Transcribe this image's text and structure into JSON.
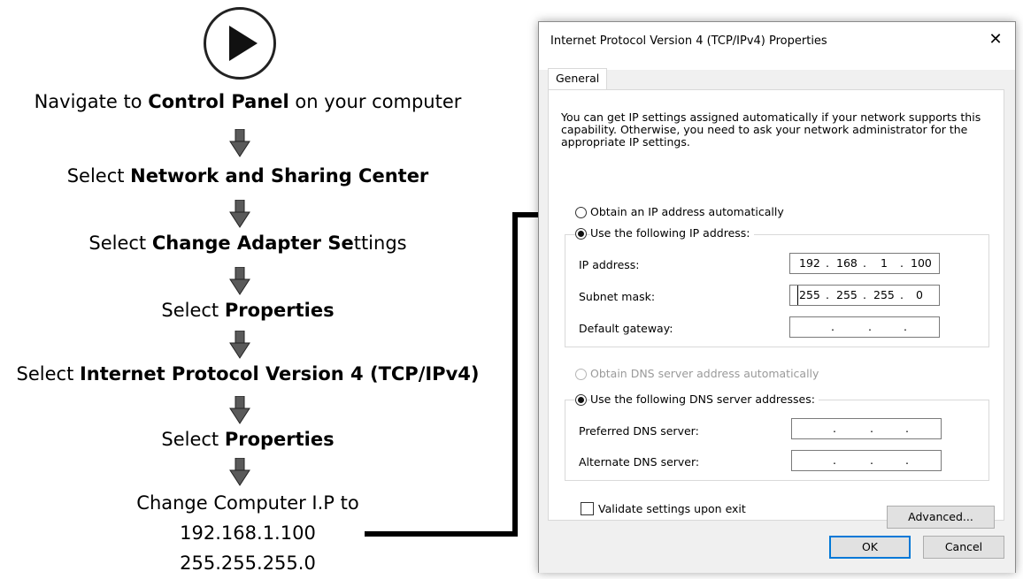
{
  "steps": {
    "items": [
      {
        "pre": "Navigate to ",
        "bold": "Control Panel",
        "post": " on your computer"
      },
      {
        "pre": "Select ",
        "bold": "Network and Sharing Center",
        "post": ""
      },
      {
        "pre": "Select ",
        "bold": "Change Adapter Se",
        "post": "ttings"
      },
      {
        "pre": "Select ",
        "bold": "Properties",
        "post": ""
      },
      {
        "pre": "Select ",
        "bold": "Internet Protocol Version 4 (TCP/IPv4)",
        "post": ""
      },
      {
        "pre": "Select ",
        "bold": "Properties",
        "post": ""
      }
    ],
    "final": {
      "line1": "Change Computer I.P to",
      "line2": "192.168.1.100",
      "line3": "255.255.255.0"
    }
  },
  "dialog": {
    "title": "Internet Protocol Version 4 (TCP/IPv4) Properties",
    "close": "✕",
    "tab": "General",
    "description": "You can get IP settings assigned automatically if your network supports this capability. Otherwise, you need to ask your network administrator for the appropriate IP settings.",
    "ip_auto_label": "Obtain an IP address automatically",
    "ip_manual_label": "Use the following IP address:",
    "ip_address_label": "IP address:",
    "ip_address": [
      "192",
      "168",
      "1",
      "100"
    ],
    "subnet_label": "Subnet mask:",
    "subnet": [
      "255",
      "255",
      "255",
      "0"
    ],
    "gateway_label": "Default gateway:",
    "gateway": [
      "",
      "",
      "",
      ""
    ],
    "dns_auto_label": "Obtain DNS server address automatically",
    "dns_manual_label": "Use the following DNS server addresses:",
    "preferred_dns_label": "Preferred DNS server:",
    "preferred_dns": [
      "",
      "",
      "",
      ""
    ],
    "alternate_dns_label": "Alternate DNS server:",
    "alternate_dns": [
      "",
      "",
      "",
      ""
    ],
    "validate_label": "Validate settings upon exit",
    "advanced_label": "Advanced...",
    "ok_label": "OK",
    "cancel_label": "Cancel"
  }
}
